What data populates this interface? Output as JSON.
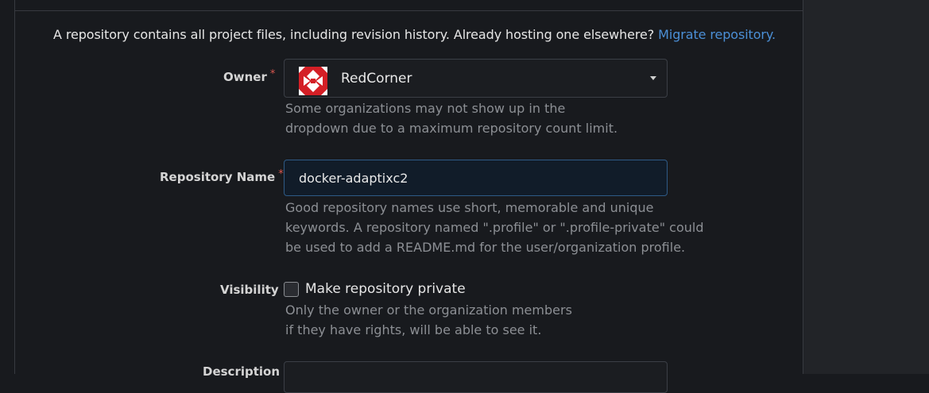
{
  "intro": {
    "text": "A repository contains all project files, including revision history. Already hosting one elsewhere?",
    "link": "Migrate repository."
  },
  "owner": {
    "label": "Owner",
    "required_mark": "*",
    "value": "RedCorner",
    "avatar_icon": "redcorner-logo-icon",
    "help_line1": "Some organizations may not show up in the",
    "help_line2": "dropdown due to a maximum repository count limit."
  },
  "repo_name": {
    "label": "Repository Name",
    "required_mark": "*",
    "value": "docker-adaptixc2",
    "help_line1": "Good repository names use short, memorable and unique",
    "help_line2": "keywords. A repository named \".profile\" or \".profile-private\" could",
    "help_line3": "be used to add a README.md for the user/organization profile."
  },
  "visibility": {
    "label": "Visibility",
    "checkbox_label": "Make repository private",
    "checked": false,
    "help_line1": "Only the owner or the organization members",
    "help_line2": "if they have rights, will be able to see it."
  },
  "description": {
    "label": "Description"
  },
  "colors": {
    "background": "#181a1e",
    "link": "#4b8fd6",
    "required": "#d9574f",
    "focus_border": "#2e5a86",
    "avatar_red": "#d41f26"
  }
}
